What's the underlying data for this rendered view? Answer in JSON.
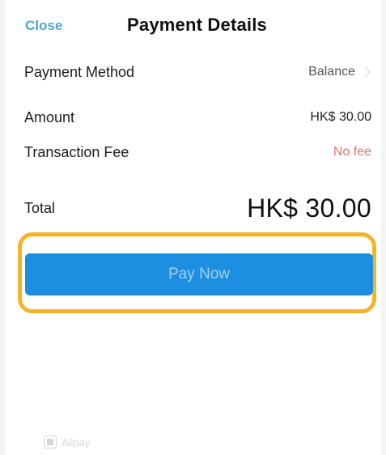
{
  "header": {
    "close_label": "Close",
    "title": "Payment Details"
  },
  "rows": {
    "payment_method": {
      "label": "Payment Method",
      "value": "Balance"
    },
    "amount": {
      "label": "Amount",
      "value": "HK$ 30.00"
    },
    "transaction_fee": {
      "label": "Transaction Fee",
      "value": "No fee"
    },
    "total": {
      "label": "Total",
      "value": "HK$ 30.00"
    }
  },
  "pay_button": {
    "label": "Pay Now"
  },
  "footer": {
    "brand_text": "Alipay"
  },
  "colors": {
    "close_link": "#4aa6cf",
    "fee_text": "#d9776a",
    "pay_button_bg": "#1e8fe0",
    "pay_button_text": "#9fd0f2",
    "highlight_frame": "#f2b428"
  },
  "icons": {
    "chevron": "chevron-right-icon",
    "footer_logo": "alipay-icon"
  }
}
